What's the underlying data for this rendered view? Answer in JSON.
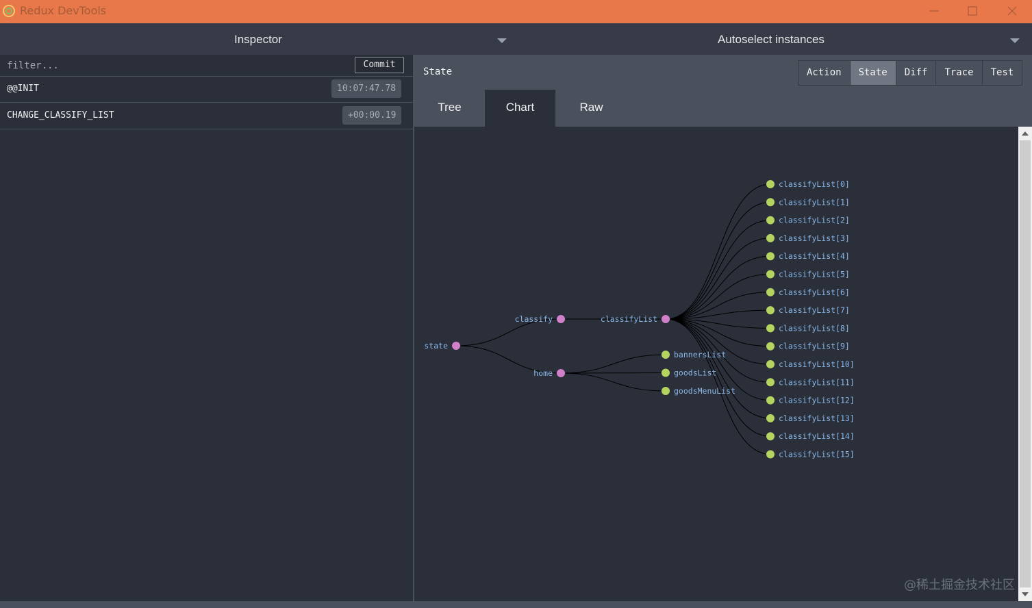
{
  "window": {
    "title": "Redux DevTools",
    "titlebar_color": "#e8784a"
  },
  "toolbar": {
    "monitor_label": "Inspector",
    "instance_label": "Autoselect instances"
  },
  "actions": {
    "filter_placeholder": "filter...",
    "commit_label": "Commit",
    "items": [
      {
        "name": "@@INIT",
        "time": "10:07:47.78"
      },
      {
        "name": "CHANGE_CLASSIFY_LIST",
        "time": "+00:00.19"
      }
    ]
  },
  "inspector": {
    "header_title": "State",
    "tabs": [
      "Action",
      "State",
      "Diff",
      "Trace",
      "Test"
    ],
    "active_tab": "State",
    "subtabs": [
      "Tree",
      "Chart",
      "Raw"
    ],
    "active_subtab": "Chart"
  },
  "tree_chart": {
    "node_colors": {
      "branch": "#d080c8",
      "leaf": "#b5d35f",
      "label": "#8ab8e8",
      "link": "#000000"
    },
    "nodes": {
      "root": "state",
      "level1": [
        "classify",
        "home"
      ],
      "classify_children": [
        "classifyList"
      ],
      "home_children": [
        "bannersList",
        "goodsList",
        "goodsMenuList"
      ],
      "classifyList_children": [
        "classifyList[0]",
        "classifyList[1]",
        "classifyList[2]",
        "classifyList[3]",
        "classifyList[4]",
        "classifyList[5]",
        "classifyList[6]",
        "classifyList[7]",
        "classifyList[8]",
        "classifyList[9]",
        "classifyList[10]",
        "classifyList[11]",
        "classifyList[12]",
        "classifyList[13]",
        "classifyList[14]",
        "classifyList[15]"
      ]
    }
  },
  "watermark": "@稀土掘金技术社区"
}
